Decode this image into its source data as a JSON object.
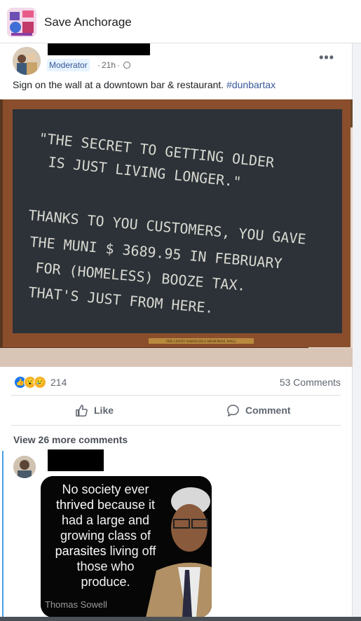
{
  "group": {
    "name": "Save Anchorage",
    "thumb_icon": "group-cover-image"
  },
  "post": {
    "author_badge": "Moderator",
    "time": "21h",
    "separator": "·",
    "privacy_icon": "globe-icon",
    "more_icon": "more-options-icon",
    "text": "Sign on the wall at a downtown bar & restaurant.",
    "hashtag": "#dunbartax",
    "photo": {
      "line1": "\"THE SECRET TO GETTING OLDER",
      "line2": "IS JUST LIVING LONGER.\"",
      "line3": "THANKS TO YOU CUSTOMERS, YOU GAVE",
      "line4": "THE MUNI $ 3689.95 IN FEBRUARY",
      "line5": "FOR (HOMELESS) BOOZE TAX.",
      "line6": "THAT'S JUST FROM HERE.",
      "plaque": "THE LENNY HARISCHUS MEMORIAL WALL"
    }
  },
  "stats": {
    "reaction_count": "214",
    "comments_label": "53 Comments"
  },
  "actions": {
    "like": "Like",
    "comment": "Comment"
  },
  "comments": {
    "view_more": "View 26 more comments",
    "meme": {
      "text_1": "No society ever",
      "text_2": "thrived",
      "text_3": " because it",
      "text_4": "had a large and",
      "text_5": "growing class of",
      "text_6": "parasites",
      "text_7": " living off",
      "text_8": "those who",
      "text_9": "produce.",
      "credit": "Thomas Sowell"
    }
  },
  "colors": {
    "link": "#385898",
    "chalkboard": "#2c3238",
    "frame": "#8a4e2c",
    "like_blue": "#1877f2"
  }
}
